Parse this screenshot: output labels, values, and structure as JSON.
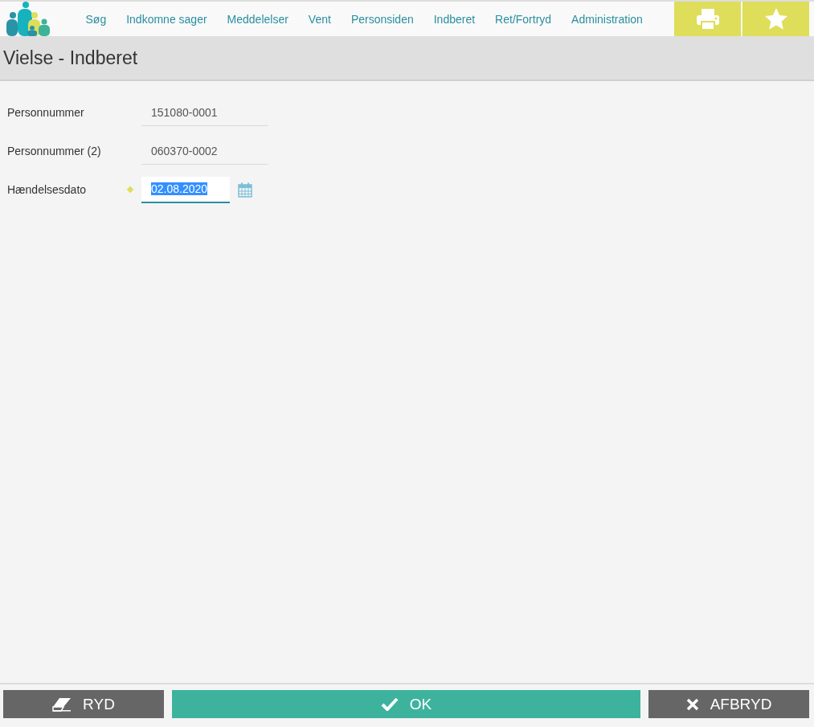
{
  "nav": {
    "items": [
      "Søg",
      "Indkomne sager",
      "Meddelelser",
      "Vent",
      "Personsiden",
      "Indberet",
      "Ret/Fortryd",
      "Administration"
    ]
  },
  "page_title": "Vielse - Indberet",
  "fields": [
    {
      "label": "Personnummer",
      "value": "151080-0001",
      "kind": "readonly",
      "required": false,
      "value_selected": false
    },
    {
      "label": "Personnummer (2)",
      "value": "060370-0002",
      "kind": "readonly",
      "required": false,
      "value_selected": false
    },
    {
      "label": "Hændelsesdato",
      "value": "02.08.2020",
      "kind": "date",
      "required": true,
      "value_selected": true
    }
  ],
  "actions": [
    {
      "label": "RYD",
      "kind": "clear"
    },
    {
      "label": "OK",
      "kind": "ok"
    },
    {
      "label": "AFBRYD",
      "kind": "cancel"
    }
  ]
}
